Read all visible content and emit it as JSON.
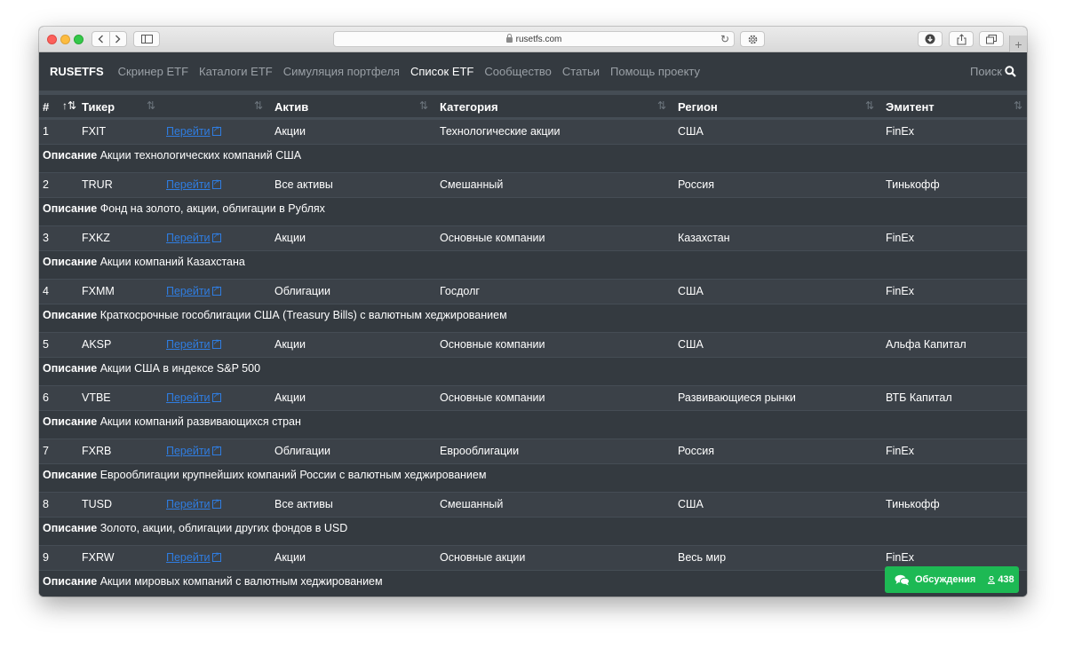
{
  "browser": {
    "url": "rusetfs.com",
    "plus_tab": "+"
  },
  "navbar": {
    "brand": "RUSETFS",
    "links": [
      {
        "label": "Скринер ETF",
        "active": false
      },
      {
        "label": "Каталоги ETF",
        "active": false
      },
      {
        "label": "Симуляция портфеля",
        "active": false
      },
      {
        "label": "Список ETF",
        "active": true
      },
      {
        "label": "Сообщество",
        "active": false
      },
      {
        "label": "Статьи",
        "active": false
      },
      {
        "label": "Помощь проекту",
        "active": false
      }
    ],
    "search_label": "Поиск",
    "search_icon": "search-icon"
  },
  "table": {
    "headers": {
      "num": "#",
      "ticker": "Тикер",
      "asset": "Актив",
      "category": "Категория",
      "region": "Регион",
      "issuer": "Эмитент"
    },
    "sort_icon": "⇅",
    "sort_active_icon": "↑",
    "description_label": "Описание",
    "rows": [
      {
        "num": "1",
        "ticker": "FXIT",
        "link": "Перейти",
        "asset": "Акции",
        "category": "Технологические акции",
        "region": "США",
        "issuer": "FinEx",
        "description": "Акции технологических компаний США"
      },
      {
        "num": "2",
        "ticker": "TRUR",
        "link": "Перейти",
        "asset": "Все активы",
        "category": "Смешанный",
        "region": "Россия",
        "issuer": "Тинькофф",
        "description": "Фонд на золото, акции, облигации в Рублях"
      },
      {
        "num": "3",
        "ticker": "FXKZ",
        "link": "Перейти",
        "asset": "Акции",
        "category": "Основные компании",
        "region": "Казахстан",
        "issuer": "FinEx",
        "description": "Акции компаний Казахстана"
      },
      {
        "num": "4",
        "ticker": "FXMM",
        "link": "Перейти",
        "asset": "Облигации",
        "category": "Госдолг",
        "region": "США",
        "issuer": "FinEx",
        "description": "Краткосрочные гособлигации США (Treasury Bills) с валютным хеджированием"
      },
      {
        "num": "5",
        "ticker": "AKSP",
        "link": "Перейти",
        "asset": "Акции",
        "category": "Основные компании",
        "region": "США",
        "issuer": "Альфа Капитал",
        "description": "Акции США в индексе S&P 500"
      },
      {
        "num": "6",
        "ticker": "VTBE",
        "link": "Перейти",
        "asset": "Акции",
        "category": "Основные компании",
        "region": "Развивающиеся рынки",
        "issuer": "ВТБ Капитал",
        "description": "Акции компаний развивающихся стран"
      },
      {
        "num": "7",
        "ticker": "FXRB",
        "link": "Перейти",
        "asset": "Облигации",
        "category": "Еврооблигации",
        "region": "Россия",
        "issuer": "FinEx",
        "description": "Еврооблигации крупнейших компаний России с валютным хеджированием"
      },
      {
        "num": "8",
        "ticker": "TUSD",
        "link": "Перейти",
        "asset": "Все активы",
        "category": "Смешанный",
        "region": "США",
        "issuer": "Тинькофф",
        "description": "Золото, акции, облигации других фондов в USD"
      },
      {
        "num": "9",
        "ticker": "FXRW",
        "link": "Перейти",
        "asset": "Акции",
        "category": "Основные акции",
        "region": "Весь мир",
        "issuer": "FinEx",
        "description": "Акции мировых компаний с валютным хеджированием"
      }
    ]
  },
  "discussion": {
    "label": "Обсуждения",
    "count": "438",
    "color": "#1db954"
  }
}
